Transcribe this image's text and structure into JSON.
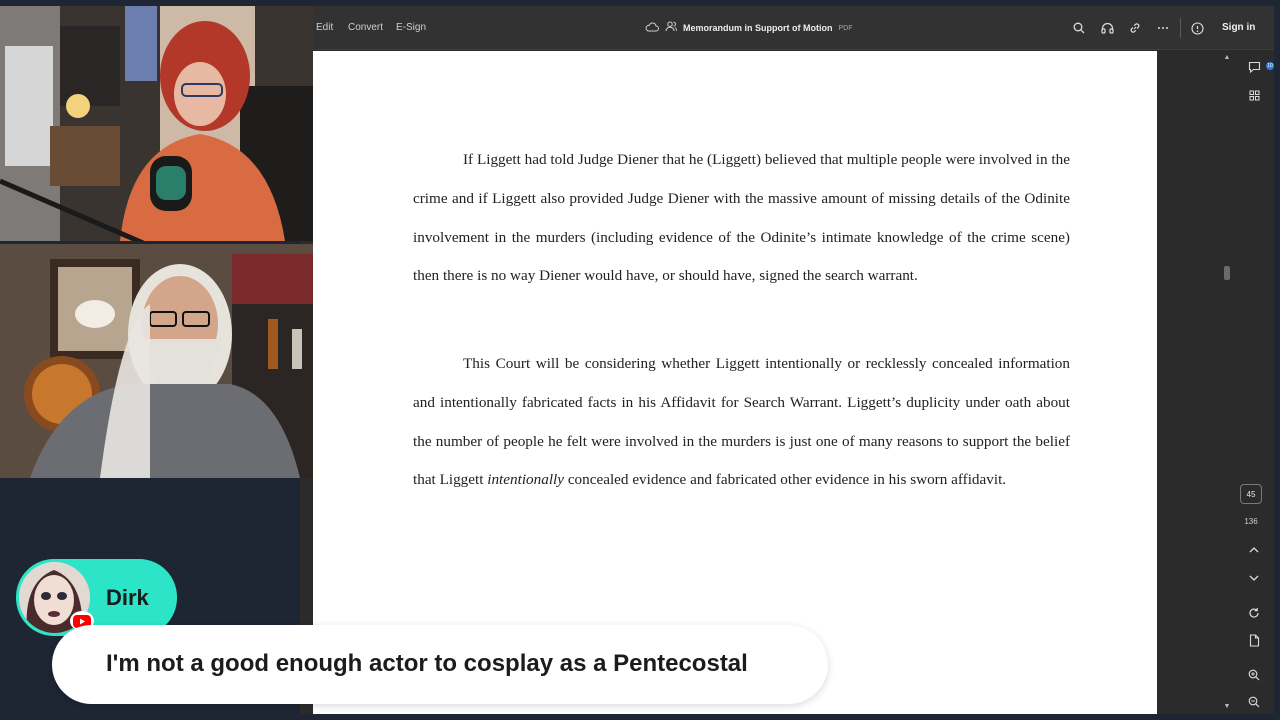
{
  "viewer": {
    "menu": [
      "Edit",
      "Convert",
      "E-Sign"
    ],
    "doc_title": "Memorandum in Support of Motion",
    "doc_type": "PDF",
    "signin_label": "Sign in",
    "page_current": "45",
    "page_total": "136",
    "chat_badge": "10"
  },
  "document": {
    "para1": "If Liggett had told Judge Diener that he (Liggett) believed that multiple people were involved in the crime and if Liggett also provided Judge Diener with the massive amount of missing details of the Odinite involvement in the murders (including evidence of the Odinite’s intimate knowledge of the crime scene) then there is no way Diener would have, or should have, signed the search warrant.",
    "para2_a": "This Court will be considering whether Liggett intentionally or recklessly concealed information and intentionally fabricated facts in his Affidavit for Search Warrant. Liggett’s duplicity under oath about the number of people he felt were involved in the murders is just one of many reasons to support the belief that Liggett ",
    "para2_em": "intentionally",
    "para2_b": " concealed evidence and fabricated other evidence in his sworn affidavit."
  },
  "chat": {
    "username": "Dirk",
    "message": "I'm not a good enough actor to cosplay as a Pentecostal"
  },
  "colors": {
    "chat_accent": "#2ce5c8",
    "youtube_red": "#ff0000",
    "page_bg": "#ffffff",
    "toolbar_bg": "#323232"
  },
  "icons": [
    "cloud-icon",
    "people-icon",
    "search-icon",
    "headphones-icon",
    "link-icon",
    "more-icon",
    "help-icon",
    "comment-icon",
    "grid-icon",
    "chevron-up-icon",
    "chevron-down-icon",
    "refresh-icon",
    "document-icon",
    "zoom-in-icon",
    "zoom-out-icon",
    "youtube-icon"
  ]
}
